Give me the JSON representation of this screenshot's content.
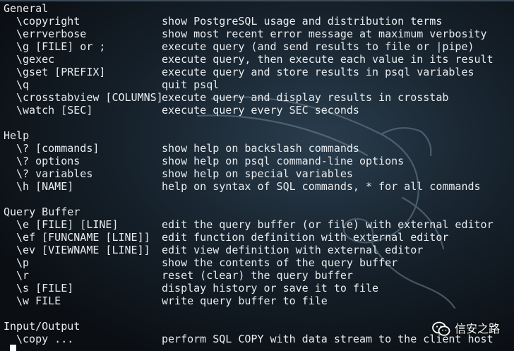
{
  "colors": {
    "background": "#0b0f14",
    "text": "#e8ecef",
    "cursor": "#ffffff"
  },
  "sections": [
    {
      "title": "General",
      "items": [
        {
          "cmd": "\\copyright",
          "desc": "show PostgreSQL usage and distribution terms"
        },
        {
          "cmd": "\\errverbose",
          "desc": "show most recent error message at maximum verbosity"
        },
        {
          "cmd": "\\g [FILE] or ;",
          "desc": "execute query (and send results to file or |pipe)"
        },
        {
          "cmd": "\\gexec",
          "desc": "execute query, then execute each value in its result"
        },
        {
          "cmd": "\\gset [PREFIX]",
          "desc": "execute query and store results in psql variables"
        },
        {
          "cmd": "\\q",
          "desc": "quit psql"
        },
        {
          "cmd": "\\crosstabview [COLUMNS]",
          "desc": "execute query and display results in crosstab"
        },
        {
          "cmd": "\\watch [SEC]",
          "desc": "execute query every SEC seconds"
        }
      ]
    },
    {
      "title": "Help",
      "items": [
        {
          "cmd": "\\? [commands]",
          "desc": "show help on backslash commands"
        },
        {
          "cmd": "\\? options",
          "desc": "show help on psql command-line options"
        },
        {
          "cmd": "\\? variables",
          "desc": "show help on special variables"
        },
        {
          "cmd": "\\h [NAME]",
          "desc": "help on syntax of SQL commands, * for all commands"
        }
      ]
    },
    {
      "title": "Query Buffer",
      "items": [
        {
          "cmd": "\\e [FILE] [LINE]",
          "desc": "edit the query buffer (or file) with external editor"
        },
        {
          "cmd": "\\ef [FUNCNAME [LINE]]",
          "desc": "edit function definition with external editor"
        },
        {
          "cmd": "\\ev [VIEWNAME [LINE]]",
          "desc": "edit view definition with external editor"
        },
        {
          "cmd": "\\p",
          "desc": "show the contents of the query buffer"
        },
        {
          "cmd": "\\r",
          "desc": "reset (clear) the query buffer"
        },
        {
          "cmd": "\\s [FILE]",
          "desc": "display history or save it to file"
        },
        {
          "cmd": "\\w FILE",
          "desc": "write query buffer to file"
        }
      ]
    },
    {
      "title": "Input/Output",
      "items": [
        {
          "cmd": "\\copy ...",
          "desc": "perform SQL COPY with data stream to the client host"
        }
      ]
    }
  ],
  "watermark": {
    "text": "信安之路",
    "icon": "wechat-icon"
  },
  "background_icon": "kali-dragon-icon"
}
